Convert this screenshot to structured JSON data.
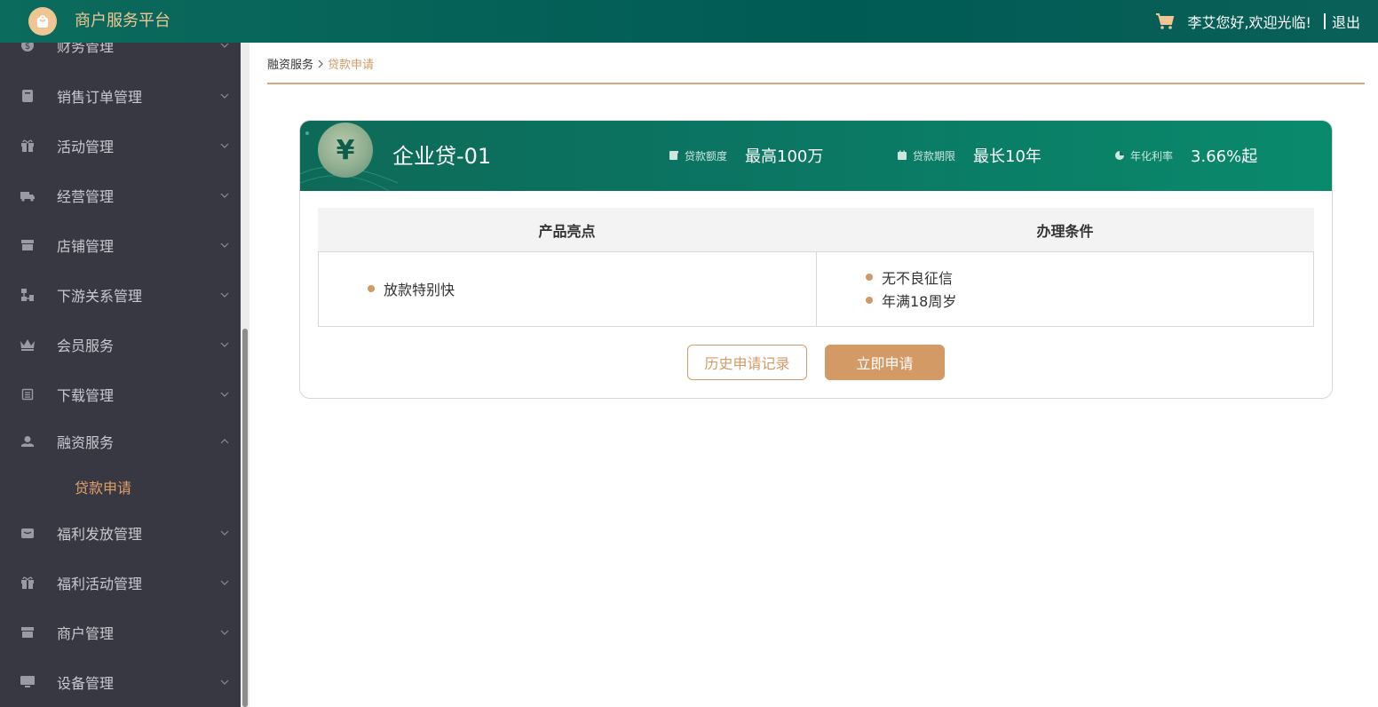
{
  "header": {
    "brand": "商户服务平台",
    "greeting": "李艾您好,欢迎光临!",
    "logout": "退出",
    "colors": {
      "bg": "#005b55",
      "brand_text": "#f2c594"
    }
  },
  "sidebar": {
    "items": [
      {
        "label": "财务管理",
        "icon": "dollar-icon"
      },
      {
        "label": "销售订单管理",
        "icon": "order-icon"
      },
      {
        "label": "活动管理",
        "icon": "gift-icon"
      },
      {
        "label": "经营管理",
        "icon": "truck-icon"
      },
      {
        "label": "店铺管理",
        "icon": "store-icon"
      },
      {
        "label": "下游关系管理",
        "icon": "hierarchy-icon"
      },
      {
        "label": "会员服务",
        "icon": "crown-icon"
      },
      {
        "label": "下载管理",
        "icon": "list-icon"
      },
      {
        "label": "融资服务",
        "icon": "finance-hand-icon",
        "expanded": true
      },
      {
        "label": "福利发放管理",
        "icon": "wallet-icon"
      },
      {
        "label": "福利活动管理",
        "icon": "gift-icon"
      },
      {
        "label": "商户管理",
        "icon": "store-icon"
      },
      {
        "label": "设备管理",
        "icon": "monitor-icon"
      }
    ],
    "submenu": {
      "label": "贷款申请",
      "active": true
    }
  },
  "breadcrumb": {
    "parent": "融资服务",
    "current": "贷款申请"
  },
  "card": {
    "product_name": "企业贷-01",
    "stats": [
      {
        "label": "贷款额度",
        "value": "最高100万",
        "icon": "document-icon"
      },
      {
        "label": "贷款期限",
        "value": "最长10年",
        "icon": "calendar-icon"
      },
      {
        "label": "年化利率",
        "value": "3.66%起",
        "icon": "pie-icon"
      }
    ],
    "table": {
      "headers": [
        "产品亮点",
        "办理条件"
      ],
      "highlights": [
        "放款特别快"
      ],
      "conditions": [
        "无不良征信",
        "年满18周岁"
      ]
    },
    "buttons": {
      "history": "历史申请记录",
      "apply": "立即申请"
    }
  }
}
